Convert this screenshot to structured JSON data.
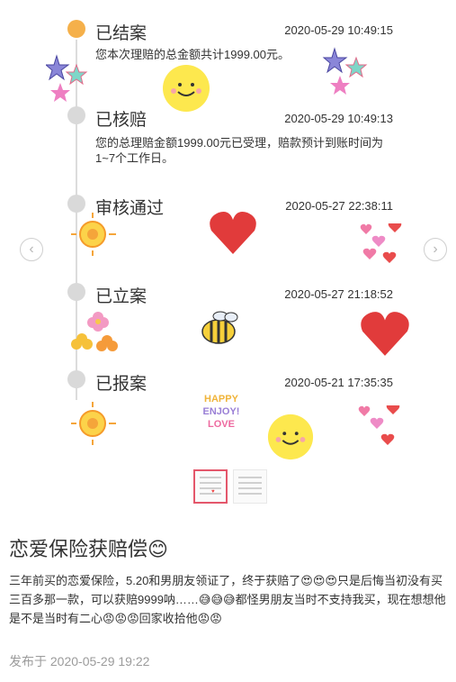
{
  "timeline": [
    {
      "status": "已结案",
      "time": "2020-05-29 10:49:15",
      "desc": "您本次理赔的总金额共计1999.00元。",
      "active": true
    },
    {
      "status": "已核赔",
      "time": "2020-05-29 10:49:13",
      "desc": "您的总理赔金额1999.00元已受理，赔款预计到账时间为1~7个工作日。",
      "active": false
    },
    {
      "status": "审核通过",
      "time": "2020-05-27 22:38:11",
      "desc": "",
      "active": false
    },
    {
      "status": "已立案",
      "time": "2020-05-27 21:18:52",
      "desc": "",
      "active": false
    },
    {
      "status": "已报案",
      "time": "2020-05-21 17:35:35",
      "desc": "",
      "active": false
    }
  ],
  "sticker_text": {
    "line1": "HAPPY",
    "line2": "ENJOY!",
    "line3": "LOVE"
  },
  "carousel": {
    "prev_icon": "chevron-left-icon",
    "next_icon": "chevron-right-icon",
    "prev_glyph": "‹",
    "next_glyph": "›"
  },
  "post": {
    "title": "恋爱保险获赔偿😊",
    "body": "三年前买的恋爱保险，5.20和男朋友领证了，终于获赔了😍😍😍只是后悔当初没有买三百多那一款，可以获赔9999呐……😅😅😅都怪男朋友当时不支持我买，现在想想他是不是当时有二心😡😡😡回家收拾他😡😡",
    "date": "发布于 2020-05-29 19:22"
  },
  "colors": {
    "active_dot": "#f5b04a",
    "inactive_dot": "#d9d9d9",
    "thumb_active_border": "#e4576b",
    "date_gray": "#9b9b9b"
  }
}
